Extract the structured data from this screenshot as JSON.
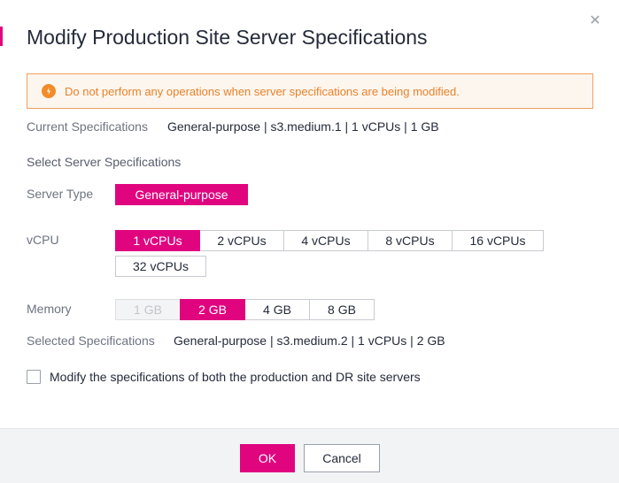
{
  "dialog": {
    "title": "Modify Production Site Server Specifications",
    "close_icon": "close-icon",
    "accent_color": "#e0057f"
  },
  "alert": {
    "icon": "warning-icon",
    "text": "Do not perform any operations when server specifications are being modified."
  },
  "current_specs": {
    "label": "Current Specifications",
    "value": "General-purpose | s3.medium.1 | 1 vCPUs | 1 GB"
  },
  "select_section": {
    "title": "Select Server Specifications"
  },
  "server_type": {
    "label": "Server Type",
    "options": [
      {
        "label": "General-purpose",
        "state": "selected"
      }
    ]
  },
  "vcpu": {
    "label": "vCPU",
    "options": [
      {
        "label": "1 vCPUs",
        "state": "selected"
      },
      {
        "label": "2 vCPUs",
        "state": "normal"
      },
      {
        "label": "4 vCPUs",
        "state": "normal"
      },
      {
        "label": "8 vCPUs",
        "state": "normal"
      },
      {
        "label": "16 vCPUs",
        "state": "normal"
      },
      {
        "label": "32 vCPUs",
        "state": "normal"
      }
    ]
  },
  "memory": {
    "label": "Memory",
    "options": [
      {
        "label": "1 GB",
        "state": "disabled"
      },
      {
        "label": "2 GB",
        "state": "selected"
      },
      {
        "label": "4 GB",
        "state": "normal"
      },
      {
        "label": "8 GB",
        "state": "normal"
      }
    ]
  },
  "selected_specs": {
    "label": "Selected Specifications",
    "value": "General-purpose | s3.medium.2 | 1 vCPUs | 2 GB"
  },
  "both_sites": {
    "label": "Modify the specifications of both the production and DR site servers",
    "checked": false
  },
  "footer": {
    "ok_label": "OK",
    "cancel_label": "Cancel"
  }
}
